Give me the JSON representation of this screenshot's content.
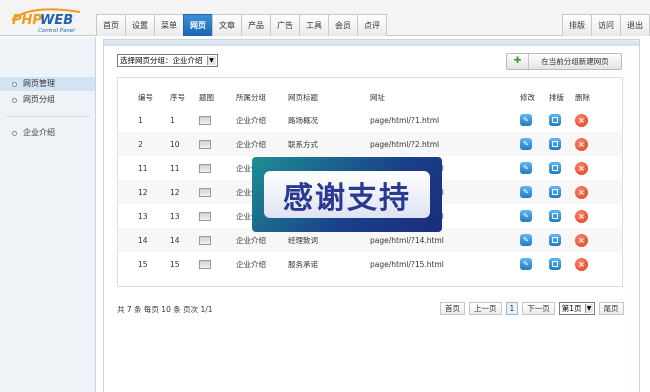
{
  "logo": {
    "word": "PHPWEB",
    "sub": "Control Panel"
  },
  "nav": {
    "items": [
      "首页",
      "设置",
      "菜单",
      "网页",
      "文章",
      "产品",
      "广告",
      "工具",
      "会员",
      "点评"
    ],
    "active_index": 3,
    "right": [
      "排版",
      "访问",
      "退出"
    ]
  },
  "sidebar": {
    "items": [
      "网页管理",
      "网页分组",
      "企业介绍"
    ],
    "selected_index": 0
  },
  "toolbar": {
    "group_select": "选择网页分组：企业介绍",
    "new_button": "在当前分组新建网页"
  },
  "table": {
    "headers": [
      "编号",
      "序号",
      "题图",
      "所属分组",
      "网页标题",
      "网址",
      "修改",
      "排版",
      "删除"
    ],
    "rows": [
      {
        "id": "1",
        "seq": "1",
        "group": "企业介绍",
        "title": "路场概况",
        "url": "page/html/?1.html"
      },
      {
        "id": "2",
        "seq": "10",
        "group": "企业介绍",
        "title": "联系方式",
        "url": "page/html/?2.html"
      },
      {
        "id": "11",
        "seq": "11",
        "group": "企业介绍",
        "title": "",
        "url": "page/html/?11.html"
      },
      {
        "id": "12",
        "seq": "12",
        "group": "企业介绍",
        "title": "",
        "url": "page/html/?12.html"
      },
      {
        "id": "13",
        "seq": "13",
        "group": "企业介绍",
        "title": "",
        "url": "page/html/?13.html"
      },
      {
        "id": "14",
        "seq": "14",
        "group": "企业介绍",
        "title": "经理致词",
        "url": "page/html/?14.html"
      },
      {
        "id": "15",
        "seq": "15",
        "group": "企业介绍",
        "title": "服务承诺",
        "url": "page/html/?15.html"
      }
    ]
  },
  "pagination": {
    "info": "共 7 条  每页 10 条  页次 1/1",
    "first": "首页",
    "prev": "上一页",
    "current": "1",
    "next": "下一页",
    "page_select": "第1页",
    "last": "尾页"
  },
  "overlay": {
    "text": "感谢支持"
  },
  "colors": {
    "nav_active": "#1d64b0",
    "sidebar_bg": "#eef3f8",
    "edit_icon": "#1f7cc7",
    "delete_icon": "#d63a16",
    "banner": "#1b3f8a"
  }
}
